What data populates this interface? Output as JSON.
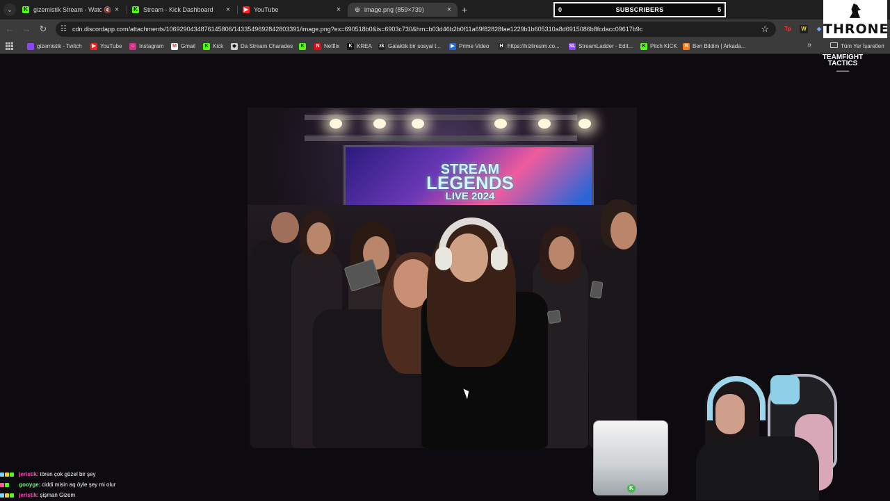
{
  "browser": {
    "tabs": [
      {
        "label": "gizemistik Stream - Watch",
        "icon": "kick-k-icon",
        "color": "#53fc18",
        "active": false
      },
      {
        "label": "Stream - Kick Dashboard",
        "icon": "kick-k-icon",
        "color": "#53fc18",
        "active": false
      },
      {
        "label": "YouTube",
        "icon": "youtube-icon",
        "color": "#ff1e1e",
        "active": false
      },
      {
        "label": "image.png (859×739)",
        "icon": "globe-icon",
        "color": "#cfcfcf",
        "active": true
      }
    ],
    "url": "cdn.discordapp.com/attachments/1069290434876145806/1433549692842803391/image.png?ex=690518b0&is=6903c730&hm=b03d46b2b0f11a69f82828fae1229b1b605310a8d6915086b8fcdacc09617b9c",
    "bookmarks": [
      {
        "label": "gizemistik - Twitch",
        "icon": "twitch-icon",
        "color": "#8b44f7"
      },
      {
        "label": "YouTube",
        "icon": "youtube-icon",
        "color": "#ff1e1e"
      },
      {
        "label": "Instagram",
        "icon": "instagram-icon",
        "color": "#d43089"
      },
      {
        "label": "Gmail",
        "icon": "gmail-icon",
        "color": "#d93025"
      },
      {
        "label": "Kick",
        "icon": "kick-k-icon",
        "color": "#53fc18"
      },
      {
        "label": "Da Stream Charades",
        "icon": "tag-icon",
        "color": "#cfcfcf"
      },
      {
        "label": "",
        "icon": "kick-k-icon",
        "color": "#53fc18"
      },
      {
        "label": "Netflix",
        "icon": "netflix-icon",
        "color": "#e50914"
      },
      {
        "label": "KREA",
        "icon": "krea-icon",
        "color": "#111111"
      },
      {
        "label": "Galaktik bir sosyal t...",
        "icon": "zk-icon",
        "color": "#232323"
      },
      {
        "label": "Prime Video",
        "icon": "prime-video-icon",
        "color": "#1f6bd7"
      },
      {
        "label": "https://hizliresim.co...",
        "icon": "h-icon",
        "color": "#2e2e2e"
      },
      {
        "label": "StreamLadder - Edit...",
        "icon": "streamladder-icon",
        "color": "#8d48ef"
      },
      {
        "label": "Pitch KICK",
        "icon": "kick-k-icon",
        "color": "#53fc18"
      },
      {
        "label": "Ben Bildim | Arkada...",
        "icon": "ben-bildim-icon",
        "color": "#ff7b1f"
      }
    ],
    "all_bookmarks": "Tüm Yer İşaretleri"
  },
  "overlay": {
    "subscribers_left": "0",
    "subscribers_label": "SUBSCRIBERS",
    "subscribers_right": "5",
    "throne": "THRONE",
    "tft_top": "TEAMFIGHT",
    "tft_bottom": "TACTICS"
  },
  "image_content": {
    "stage_line1": "STREAM",
    "stage_line2": "LEGENDS",
    "stage_line3": "LIVE 2024"
  },
  "chat": [
    {
      "user": "jeristik",
      "user_color": "#ff4bb5",
      "message": ": tören çok güzel bir şey"
    },
    {
      "user": "gooyge",
      "user_color": "#78f27b",
      "message": ": ciddi misin aq öyle şey mi olur"
    },
    {
      "user": "jeristik",
      "user_color": "#ff4bb5",
      "message": ": şişman Gizem"
    }
  ],
  "colors": {
    "accent_green": "#53fc18",
    "browser_tab_active": "#3b3b3b",
    "browser_toolbar": "#3b3b3b"
  }
}
